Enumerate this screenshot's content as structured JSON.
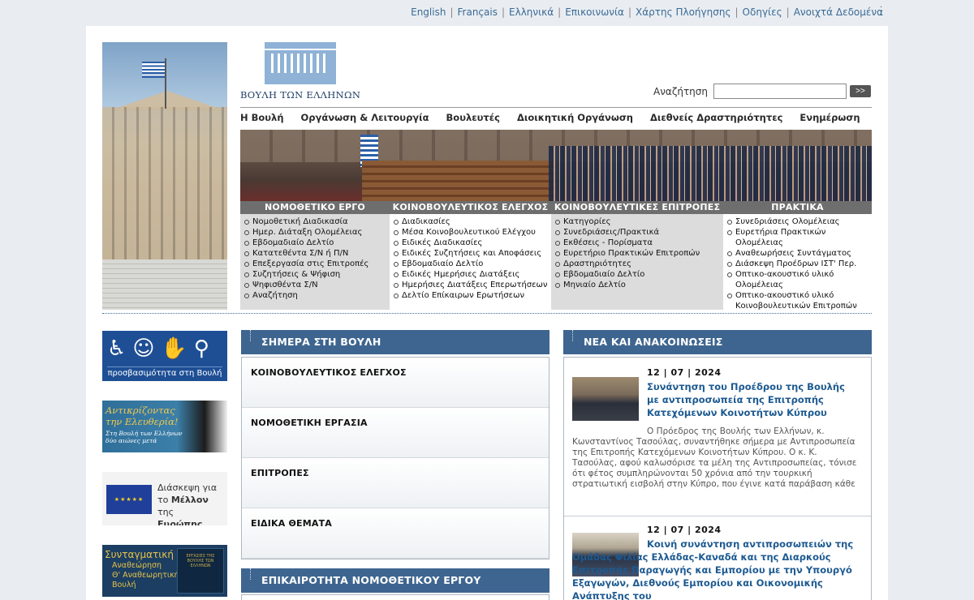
{
  "util_links": [
    "English",
    "Français",
    "Ελληνικά",
    "Επικοινωνία",
    "Χάρτης Πλοήγησης",
    "Οδηγίες",
    "Ανοιχτά Δεδομένα"
  ],
  "logo_text": "ΒΟΥΛΗ ΤΩΝ ΕΛΛΗΝΩΝ",
  "search": {
    "label": "Αναζήτηση",
    "value": "",
    "button": ">>"
  },
  "main_nav": [
    "Η Βουλή",
    "Οργάνωση & Λειτουργία",
    "Βουλευτές",
    "Διοικητική Οργάνωση",
    "Διεθνείς Δραστηριότητες",
    "Ενημέρωση"
  ],
  "sections": [
    {
      "title": "ΝΟΜΟΘΕΤΙΚΟ ΕΡΓΟ",
      "items": [
        "Νομοθετική Διαδικασία",
        "Ημερ. Διάταξη Ολομέλειας",
        "Εβδομαδιαίο Δελτίο",
        "Κατατεθέντα Σ/Ν ή Π/Ν",
        "Επεξεργασία στις Επιτροπές",
        "Συζητήσεις & Ψήφιση",
        "Ψηφισθέντα Σ/Ν",
        "Αναζήτηση"
      ]
    },
    {
      "title": "ΚΟΙΝΟΒΟΥΛΕΥΤΙΚΟΣ ΕΛΕΓΧΟΣ",
      "items": [
        "Διαδικασίες",
        "Μέσα Κοινοβουλευτικού Ελέγχου",
        "Ειδικές Διαδικασίες",
        "Ειδικές Συζητήσεις και Αποφάσεις",
        "Εβδομαδιαίο Δελτίο",
        "Ειδικές Ημερήσιες Διατάξεις",
        "Ημερήσιες Διατάξεις Επερωτήσεων",
        "Δελτίο Επίκαιρων Ερωτήσεων"
      ]
    },
    {
      "title": "ΚΟΙΝΟΒΟΥΛΕΥΤΙΚΕΣ ΕΠΙΤΡΟΠΕΣ",
      "items": [
        "Κατηγορίες",
        "Συνεδριάσεις/Πρακτικά",
        "Εκθέσεις - Πορίσματα",
        "Ευρετήριο Πρακτικών Επιτροπών",
        "Δραστηριότητες",
        "Εβδομαδιαίο Δελτίο",
        "Μηνιαίο Δελτίο"
      ]
    },
    {
      "title": "ΠΡΑΚΤΙΚΑ",
      "items": [
        "Συνεδριάσεις Ολομέλειας",
        "Ευρετήρια Πρακτικών Ολομέλειας",
        "Αναθεωρήσεις Συντάγματος",
        "Διάσκεψη Προέδρων ΙΣΤ' Περ.",
        "Οπτικο-ακουστικό υλικό Ολομέλειας",
        "Οπτικο-ακουστικό υλικό Κοινοβουλευτικών Επιτροπών"
      ]
    }
  ],
  "banners": {
    "accessibility": "προσβασιμότητα στη Βουλή",
    "resistance_line1": "Αντικρίζοντας",
    "resistance_line2": "την Ελευθερία!",
    "resistance_sub1": "Στη Βουλή των Ελλήνων",
    "resistance_sub2": "δύο αιώνες μετά",
    "future_line1": "Διάσκεψη για",
    "future_line2a": "το ",
    "future_line2b": "Μέλλον",
    "future_line2c": " της",
    "future_line3": "Ευρώπης",
    "constitution_title": "Συνταγματική",
    "constitution_line2": "Αναθεώρηση",
    "constitution_line3": "Θ' Αναθεωρητική",
    "constitution_line4": "Βουλή",
    "book_text": "ΕΡΓΑΣΙΕΣ ΤΗΣ ΒΟΥΛΗΣ ΤΩΝ ΕΛΛΗΝΩΝ"
  },
  "today": {
    "title": "ΣΗΜΕΡΑ ΣΤΗ ΒΟΥΛΗ",
    "items": [
      "ΚΟΙΝΟΒΟΥΛΕΥΤΙΚΟΣ ΕΛΕΓΧΟΣ",
      "ΝΟΜΟΘΕΤΙΚΗ ΕΡΓΑΣΙΑ",
      "ΕΠΙΤΡΟΠΕΣ",
      "ΕΙΔΙΚΑ ΘΕΜΑΤΑ"
    ]
  },
  "bills_title": "ΕΠΙΚΑΙΡΟΤΗΤΑ ΝΟΜΟΘΕΤΙΚΟΥ ΕΡΓΟΥ",
  "news": {
    "title": "ΝΕΑ ΚΑΙ ΑΝΑΚΟΙΝΩΣΕΙΣ",
    "items": [
      {
        "date": "12 | 07 | 2024",
        "title": "Συνάντηση του Προέδρου της Βουλής με αντιπροσωπεία της Επιτροπής Κατεχόμενων Κοινοτήτων Κύπρου",
        "body": "Ο Πρόεδρος της Βουλής των Ελλήνων, κ. Κωνσταντίνος Τασούλας, συναντήθηκε σήμερα με Αντιπροσωπεία της Επιτροπής Κατεχόμενων Κοινοτήτων Κύπρου. Ο κ. Κ. Τασούλας, αφού καλωσόρισε τα μέλη της Αντιπροσωπείας, τόνισε ότι φέτος συμπληρώνονται 50 χρόνια από την τουρκική στρατιωτική εισβολή στην Κύπρο, που έγινε κατά παράβαση κάθε"
      },
      {
        "date": "12 | 07 | 2024",
        "title": "Κοινή συνάντηση αντιπροσωπειών της Ομάδας Φιλίας Ελλάδας-Καναδά και της Διαρκούς Επιτροπής Παραγωγής και Εμπορίου με την Υπουργό Εξαγωγών, Διεθνούς Εμπορίου και Οικονομικής Ανάπτυξης του"
      }
    ]
  }
}
